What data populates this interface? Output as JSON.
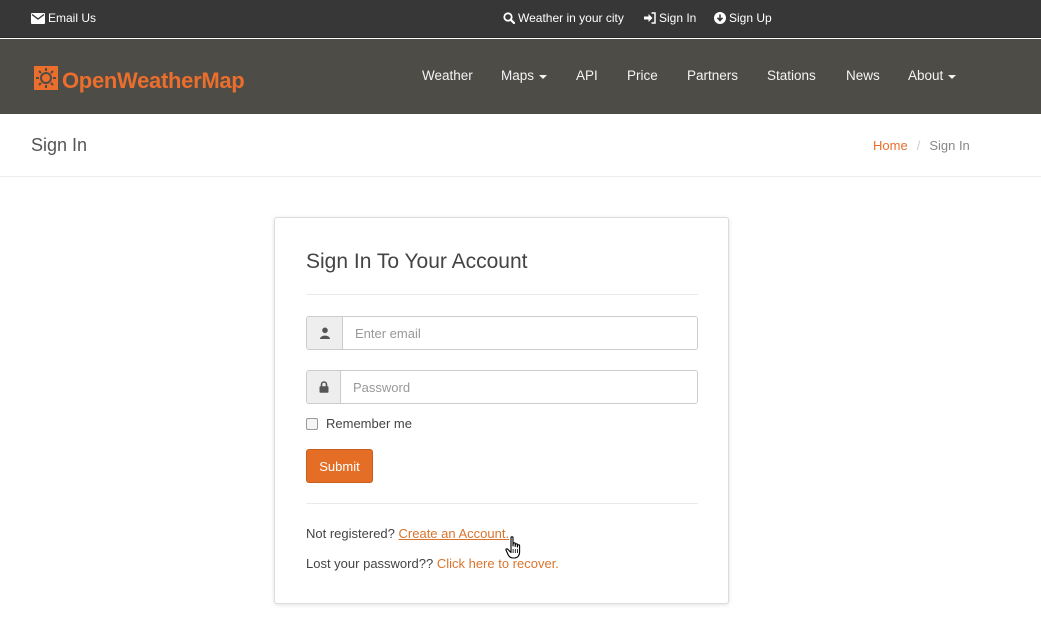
{
  "topbar": {
    "email_us": "Email Us",
    "weather_in_city": "Weather in your city",
    "sign_in": "Sign In",
    "sign_up": "Sign Up"
  },
  "brand": {
    "logo_text": "OpenWeatherMap",
    "accent_color": "#eb6e2d"
  },
  "nav": {
    "items": [
      {
        "label": "Weather",
        "dropdown": false
      },
      {
        "label": "Maps",
        "dropdown": true
      },
      {
        "label": "API",
        "dropdown": false
      },
      {
        "label": "Price",
        "dropdown": false
      },
      {
        "label": "Partners",
        "dropdown": false
      },
      {
        "label": "Stations",
        "dropdown": false
      },
      {
        "label": "News",
        "dropdown": false
      },
      {
        "label": "About",
        "dropdown": true
      }
    ]
  },
  "page": {
    "title": "Sign In",
    "breadcrumb": {
      "home": "Home",
      "separator": "/",
      "current": "Sign In"
    }
  },
  "form": {
    "heading": "Sign In To Your Account",
    "email_placeholder": "Enter email",
    "email_value": "",
    "password_placeholder": "Password",
    "password_value": "",
    "remember_label": "Remember me",
    "remember_checked": false,
    "submit_label": "Submit",
    "not_registered_text": "Not registered?",
    "create_account_link": "Create an Account.",
    "lost_password_text": "Lost your password??",
    "recover_link": "Click here to recover."
  },
  "icons": {
    "email": "envelope-icon",
    "search": "search-icon",
    "sign_in": "sign-in-icon",
    "sign_up": "sign-up-icon",
    "user": "user-icon",
    "lock": "lock-icon",
    "cursor": "hand-cursor-icon"
  },
  "colors": {
    "topbar_bg": "#373737",
    "navbar_bg": "#4d4c47",
    "submit_bg": "#e46e26",
    "link": "#d9742d"
  }
}
